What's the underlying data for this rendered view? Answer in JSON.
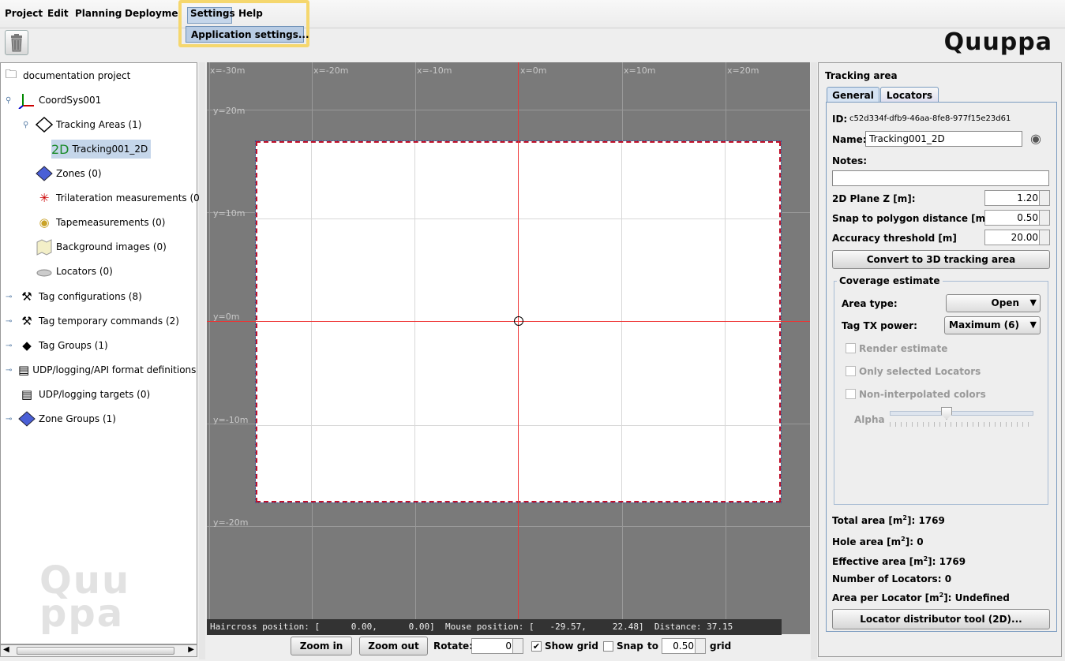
{
  "menu": {
    "project": "Project",
    "edit": "Edit",
    "planning": "Planning",
    "deployment": "Deploymen",
    "settings": "Settings",
    "help": "Help",
    "dropdown_item": "Application settings..."
  },
  "logo": "Quuppa",
  "watermark": "Quu ppa",
  "tree": {
    "root": "documentation project",
    "coordsys": "CoordSys001",
    "tracking_areas": "Tracking Areas (1)",
    "tracking_item_prefix": "2D",
    "tracking_item": "Tracking001_2D",
    "zones": "Zones (0)",
    "trilateration": "Trilateration measurements (0",
    "tape": "Tapemeasurements (0)",
    "background": "Background images (0)",
    "locators": "Locators (0)",
    "tag_configs": "Tag configurations (8)",
    "tag_temp": "Tag temporary commands (2)",
    "tag_groups": "Tag Groups (1)",
    "udp_defs": "UDP/logging/API format definitions (",
    "udp_targets": "UDP/logging targets (0)",
    "zone_groups": "Zone Groups (1)"
  },
  "canvas": {
    "xlabels": [
      "x=-30m",
      "x=-20m",
      "x=-10m",
      "x=0m",
      "x=10m",
      "x=20m"
    ],
    "ylabels": [
      "y=20m",
      "y=10m",
      "y=0m",
      "y=-10m",
      "y=-20m"
    ],
    "status": "Haircross position: [      0.00,      0.00]  Mouse position: [   -29.57,     22.48]  Distance: 37.15"
  },
  "bottom": {
    "zoom_in": "Zoom in",
    "zoom_out": "Zoom out",
    "rotate_label": "Rotate:",
    "rotate_value": "0",
    "show_grid": "Show grid",
    "snap": "Snap",
    "to": "to",
    "snap_value": "0.50",
    "grid": "grid"
  },
  "panel": {
    "title": "Tracking area",
    "tab_general": "General",
    "tab_locators": "Locators",
    "id_label": "ID:",
    "id_value": "c52d334f-dfb9-46aa-8fe8-977f15e23d61",
    "name_label": "Name:",
    "name_value": "Tracking001_2D",
    "notes_label": "Notes:",
    "plane_label": "2D Plane Z [m]:",
    "plane_value": "1.20",
    "snap_label": "Snap to polygon distance [m]",
    "snap_value": "0.50",
    "acc_label": "Accuracy threshold [m]",
    "acc_value": "20.00",
    "convert_btn": "Convert to 3D tracking area",
    "coverage_title": "Coverage estimate",
    "area_type_label": "Area type:",
    "area_type_value": "Open",
    "tx_label": "Tag TX power:",
    "tx_value": "Maximum (6)",
    "render": "Render estimate",
    "only_sel": "Only selected Locators",
    "non_interp": "Non-interpolated colors",
    "alpha": "Alpha",
    "total_area": "Total area [m",
    "total_area_value": "1769",
    "hole_area": "Hole area [m",
    "hole_area_value": "0",
    "eff_area": "Effective area [m",
    "eff_area_value": "1769",
    "num_loc": "Number of Locators:",
    "num_loc_value": "0",
    "area_per": "Area per Locator [m",
    "area_per_value": "Undefined",
    "sup": "2",
    "suffix": "]:",
    "distributor_btn": "Locator distributor tool (2D)..."
  }
}
